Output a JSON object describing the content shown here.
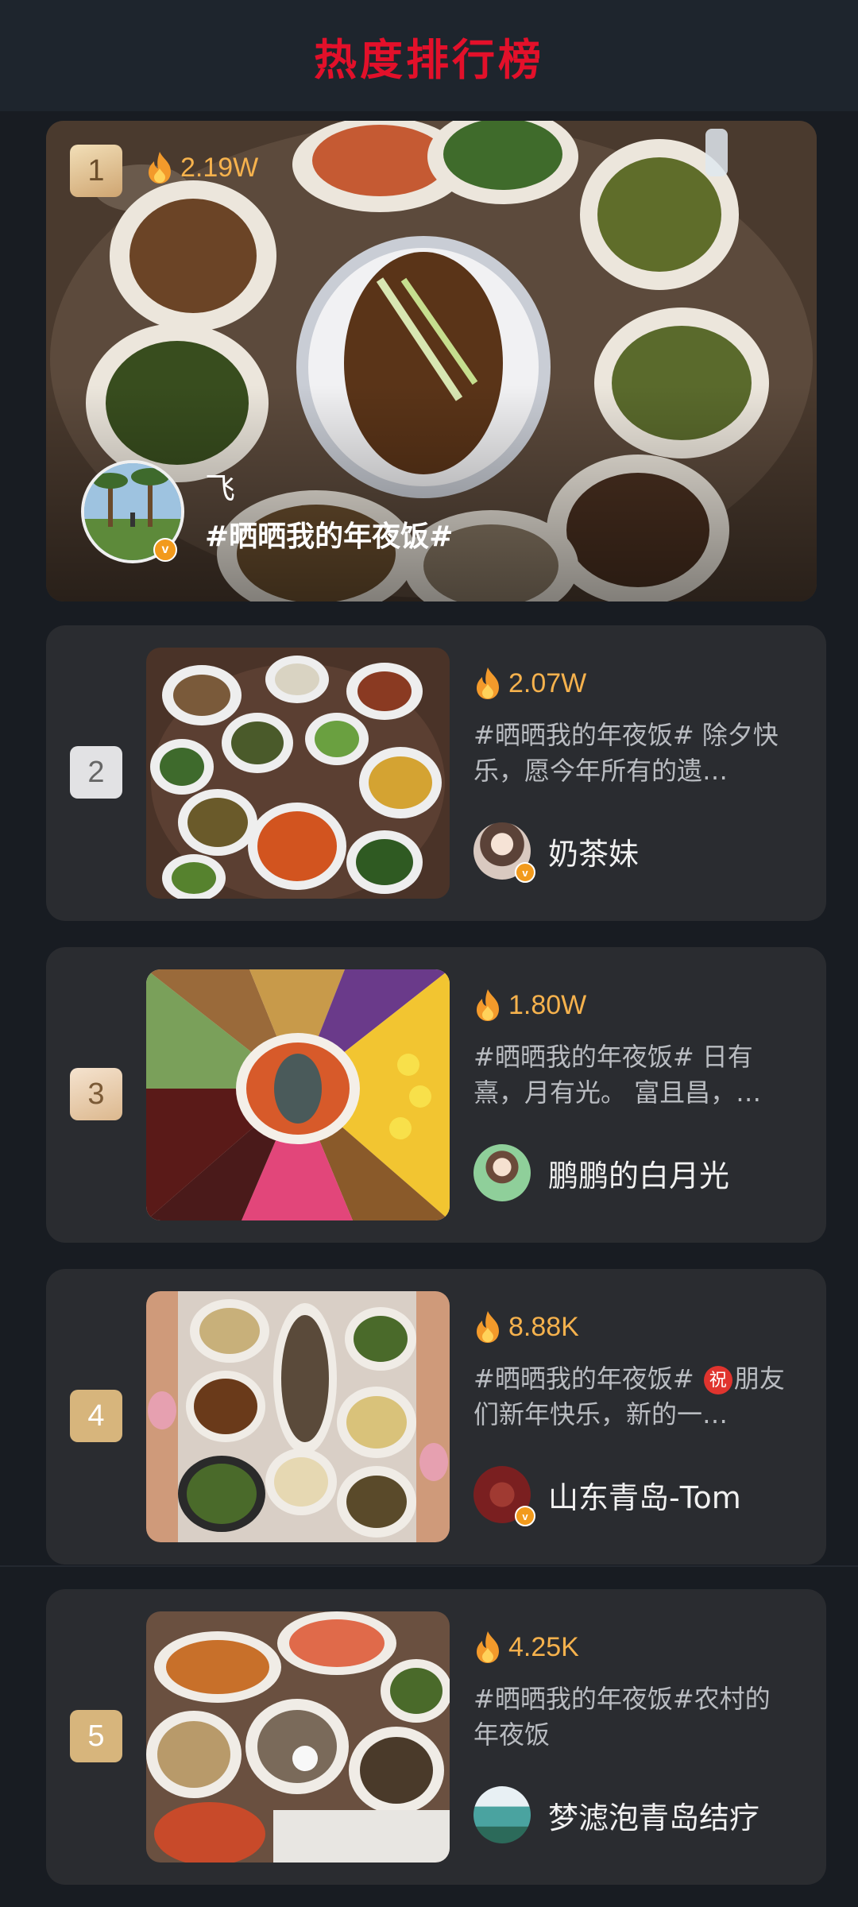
{
  "header": {
    "title": "热度排行榜"
  },
  "featured": {
    "rank": "1",
    "heat": "2.19W",
    "author": "飞",
    "tag": "#晒晒我的年夜饭#"
  },
  "items": [
    {
      "rank": "2",
      "heat": "2.07W",
      "desc": "#晒晒我的年夜饭# 除夕快乐，愿今年所有的遗…",
      "user": "奶茶妹",
      "rank_color": "#e2e2e4",
      "avatar_color": "#d9c9c0"
    },
    {
      "rank": "3",
      "heat": "1.80W",
      "desc": "#晒晒我的年夜饭# 日有熹，月有光。 富且昌，…",
      "user": "鹏鹏的白月光",
      "rank_color": "#efd6bd",
      "avatar_color": "#8fcf9a"
    },
    {
      "rank": "4",
      "heat": "8.88K",
      "desc_before": "#晒晒我的年夜饭# ",
      "desc_emoji": "祝",
      "desc_after": "朋友们新年快乐，新的一…",
      "user": "山东青岛-Tom",
      "rank_color": "#d7b57c",
      "avatar_color": "#7a1f20"
    },
    {
      "rank": "5",
      "heat": "4.25K",
      "desc": "#晒晒我的年夜饭#农村的年夜饭",
      "user": "梦滤泡青岛结疗",
      "rank_color": "#d7b57c",
      "avatar_color": "#4aa3a0"
    }
  ],
  "colors": {
    "title": "#e3102a",
    "heat": "#f6b24d",
    "card": "#2a2c30",
    "verified": "#f29a1c"
  },
  "icons": {
    "heat": "flame-icon",
    "verified": "verified-v-icon"
  }
}
